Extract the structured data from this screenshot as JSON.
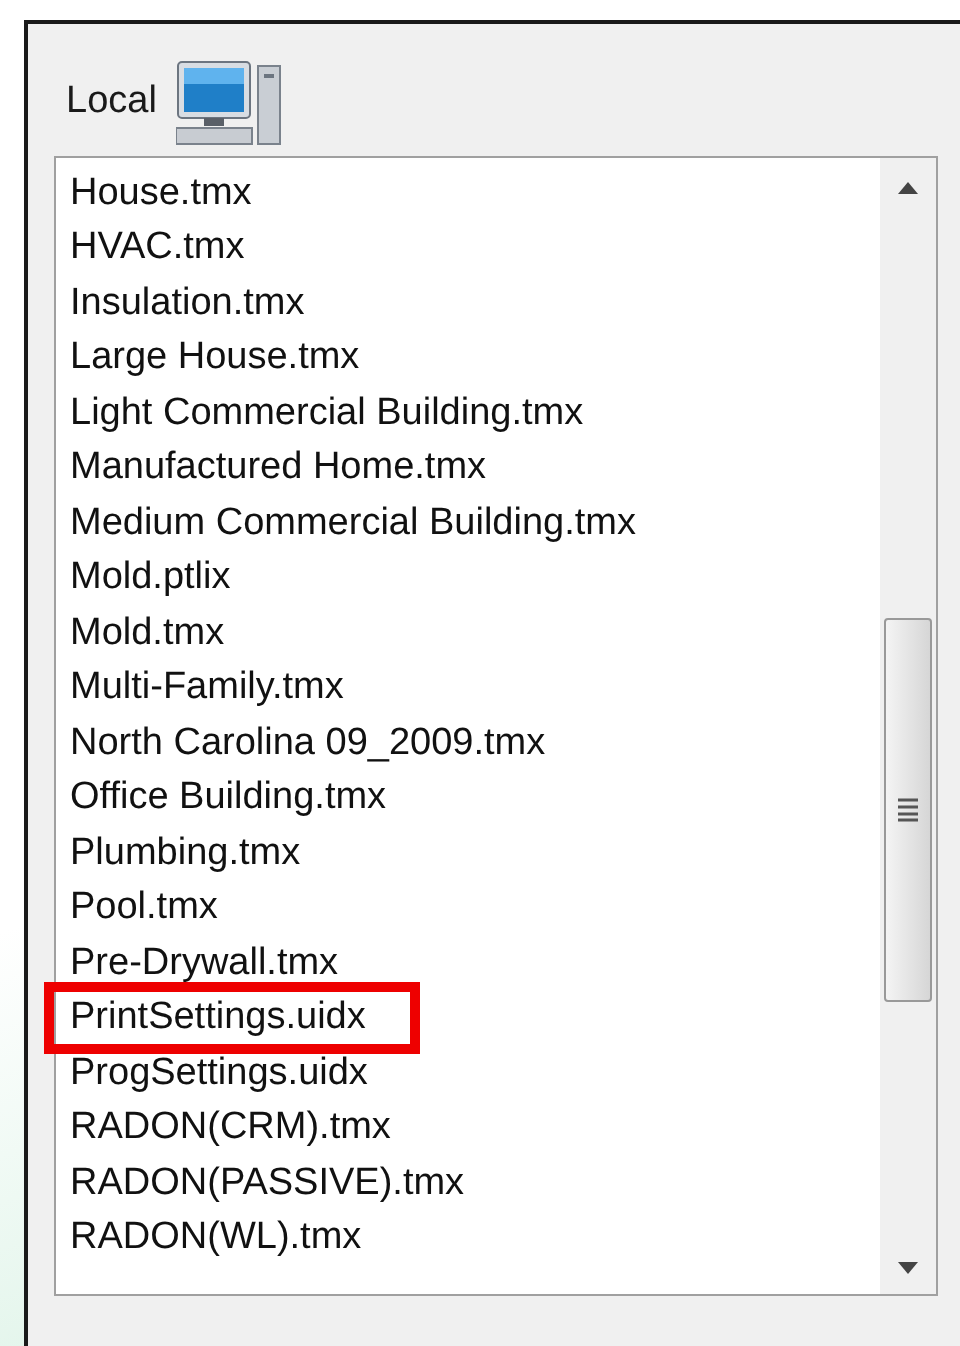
{
  "panel": {
    "label": "Local"
  },
  "files": [
    {
      "name": "House.tmx",
      "highlighted": false
    },
    {
      "name": "HVAC.tmx",
      "highlighted": false
    },
    {
      "name": "Insulation.tmx",
      "highlighted": false
    },
    {
      "name": "Large House.tmx",
      "highlighted": false
    },
    {
      "name": "Light Commercial Building.tmx",
      "highlighted": false
    },
    {
      "name": "Manufactured Home.tmx",
      "highlighted": false
    },
    {
      "name": "Medium Commercial Building.tmx",
      "highlighted": false
    },
    {
      "name": "Mold.ptlix",
      "highlighted": false
    },
    {
      "name": "Mold.tmx",
      "highlighted": false
    },
    {
      "name": "Multi-Family.tmx",
      "highlighted": false
    },
    {
      "name": "North Carolina 09_2009.tmx",
      "highlighted": false
    },
    {
      "name": "Office Building.tmx",
      "highlighted": false
    },
    {
      "name": "Plumbing.tmx",
      "highlighted": false
    },
    {
      "name": "Pool.tmx",
      "highlighted": false
    },
    {
      "name": "Pre-Drywall.tmx",
      "highlighted": false
    },
    {
      "name": "PrintSettings.uidx",
      "highlighted": true
    },
    {
      "name": "ProgSettings.uidx",
      "highlighted": false
    },
    {
      "name": "RADON(CRM).tmx",
      "highlighted": false
    },
    {
      "name": "RADON(PASSIVE).tmx",
      "highlighted": false
    },
    {
      "name": "RADON(WL).tmx",
      "highlighted": false
    }
  ]
}
